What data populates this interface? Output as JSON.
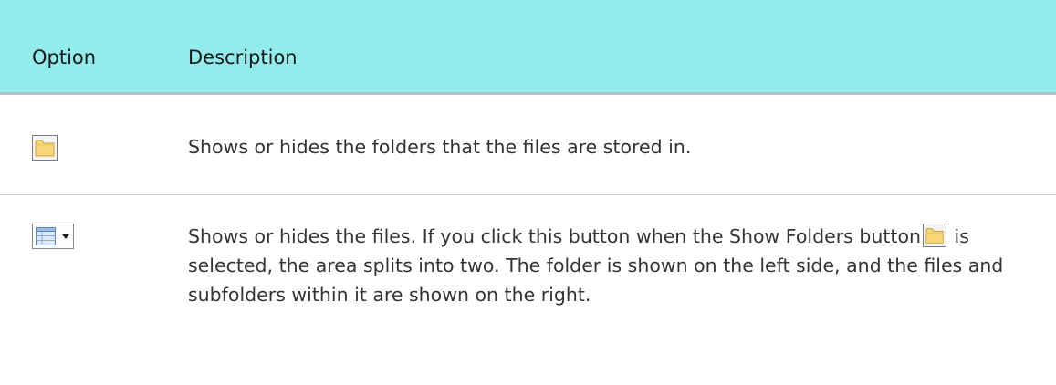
{
  "table": {
    "headers": {
      "option": "Option",
      "description": "Description"
    },
    "rows": [
      {
        "icon": "folder-icon",
        "description": "Shows or hides the folders that the files are stored in."
      },
      {
        "icon": "grid-view-icon",
        "description_parts": {
          "before_icon": "Shows or hides the files. If you click this button when the Show Folders button",
          "inline_icon": "folder-icon",
          "after_icon": "is selected, the area splits into two. The folder is shown on the left side, and the files and subfolders within it are shown on the right."
        }
      }
    ]
  },
  "colors": {
    "header_background": "#93ecec",
    "header_border": "#b9bfbf",
    "row_divider": "#cccccc",
    "text": "#333333",
    "folder_fill": "#f7d77a"
  }
}
